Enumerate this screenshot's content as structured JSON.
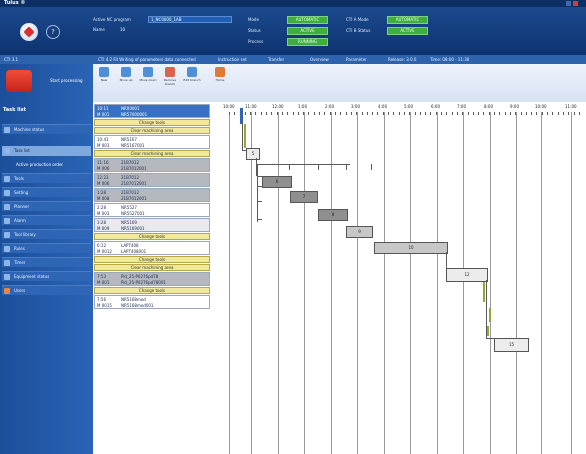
{
  "window": {
    "title": "Tulus ®"
  },
  "header": {
    "active_nc_label": "Active NC program",
    "active_nc_value": "1_NC0000_1AB",
    "name_label": "Name",
    "name_value": "10",
    "mode_label": "Mode",
    "mode_value": "AUTOMATIC",
    "status_label": "Status",
    "status_value": "ACTIVE",
    "process_label": "Process",
    "process_value": "RUNNING",
    "cnc_a_label": "CTI A Mode",
    "cnc_a_value": "AUTOMATIC",
    "cnc_b_label": "CTI B Status",
    "cnc_b_value": "ACTIVE"
  },
  "subbar": {
    "left": "CTI 3.1",
    "message": "CTI 4.2  Fit Writing of parameters data connected",
    "seg1": "Instruction set",
    "seg2": "Transfer",
    "seg3": "Overview",
    "seg4": "Parameter",
    "seg5": "Release: 3.0.0",
    "seg6": "Time: 08:00 · 11:30"
  },
  "sidebar": {
    "action_label": "Start processing",
    "task_list_title": "Task list",
    "items": [
      {
        "label": "Machine status"
      },
      {
        "label": "Task list"
      },
      {
        "label": "Active production order"
      },
      {
        "label": "Tools"
      },
      {
        "label": "Setting"
      },
      {
        "label": "Planner"
      },
      {
        "label": "Alarm"
      },
      {
        "label": "Tool library"
      },
      {
        "label": "Rules"
      },
      {
        "label": "Timer"
      },
      {
        "label": "Equipment status"
      },
      {
        "label": "Users"
      }
    ]
  },
  "toolbar": {
    "tools": [
      {
        "label": "New"
      },
      {
        "label": "Move up"
      },
      {
        "label": "Move down"
      },
      {
        "label": "Remove branch"
      },
      {
        "label": "Edit branch"
      },
      {
        "label": "Home"
      }
    ]
  },
  "tasks": [
    {
      "kind": "blue",
      "c1": "10:11",
      "c2": "NR00001",
      "c3": "M 001",
      "c4": "NR57000001"
    },
    {
      "kind": "yellow",
      "label": "Change tools"
    },
    {
      "kind": "yellow",
      "label": "Clear machining area"
    },
    {
      "kind": "white",
      "c1": "10:41",
      "c2": "NR5167",
      "c3": "M 003",
      "c4": "NR5167001"
    },
    {
      "kind": "yellow",
      "label": "Clear machining area"
    },
    {
      "kind": "grey",
      "c1": "11:16",
      "c2": "21B7012",
      "c3": "M 006",
      "c4": "21B7012001"
    },
    {
      "kind": "grey",
      "c1": "12:23",
      "c2": "21B7012",
      "c3": "M 006",
      "c4": "21B7012001"
    },
    {
      "kind": "grey",
      "c1": "1:28",
      "c2": "21B7012",
      "c3": "M 008",
      "c4": "21B7012001"
    },
    {
      "kind": "white",
      "c1": "2:28",
      "c2": "NR5527",
      "c3": "M 003",
      "c4": "NR5527001"
    },
    {
      "kind": "light",
      "c1": "3:28",
      "c2": "NR5169",
      "c3": "M 009",
      "c4": "NR5169001"
    },
    {
      "kind": "yellow",
      "label": "Change tools"
    },
    {
      "kind": "white",
      "c1": "6:12",
      "c2": "LAPT408",
      "c3": "M 0012",
      "c4": "LAPT408001"
    },
    {
      "kind": "yellow",
      "label": "Change tools"
    },
    {
      "kind": "yellow",
      "label": "Clear machining area"
    },
    {
      "kind": "grey",
      "c1": "7:53",
      "c2": "Pid_25-P0276pd78",
      "c3": "M 001",
      "c4": "Pid_25-P0276pd78001"
    },
    {
      "kind": "yellow",
      "label": "Change tools"
    },
    {
      "kind": "white",
      "c1": "7:56",
      "c2": "NR5168mod",
      "c3": "M 0015",
      "c4": "NR5168mod001"
    }
  ],
  "gantt": {
    "ticks": [
      "10:00",
      "11:00",
      "12:00",
      "1:00",
      "2:00",
      "3:00",
      "4:00",
      "5:00",
      "6:00",
      "7:00",
      "8:00",
      "9:00",
      "10:00",
      "11:00"
    ],
    "bars": [
      {
        "label": "5"
      },
      {
        "label": "6"
      },
      {
        "label": "7"
      },
      {
        "label": "8"
      },
      {
        "label": "9"
      },
      {
        "label": "10"
      },
      {
        "label": "12"
      },
      {
        "label": "15"
      }
    ]
  },
  "colors": {
    "brand_blue": "#1b4a8e",
    "action_red": "#e0392b",
    "status_green": "#3fae3f",
    "task_yellow": "#f0e89a"
  }
}
